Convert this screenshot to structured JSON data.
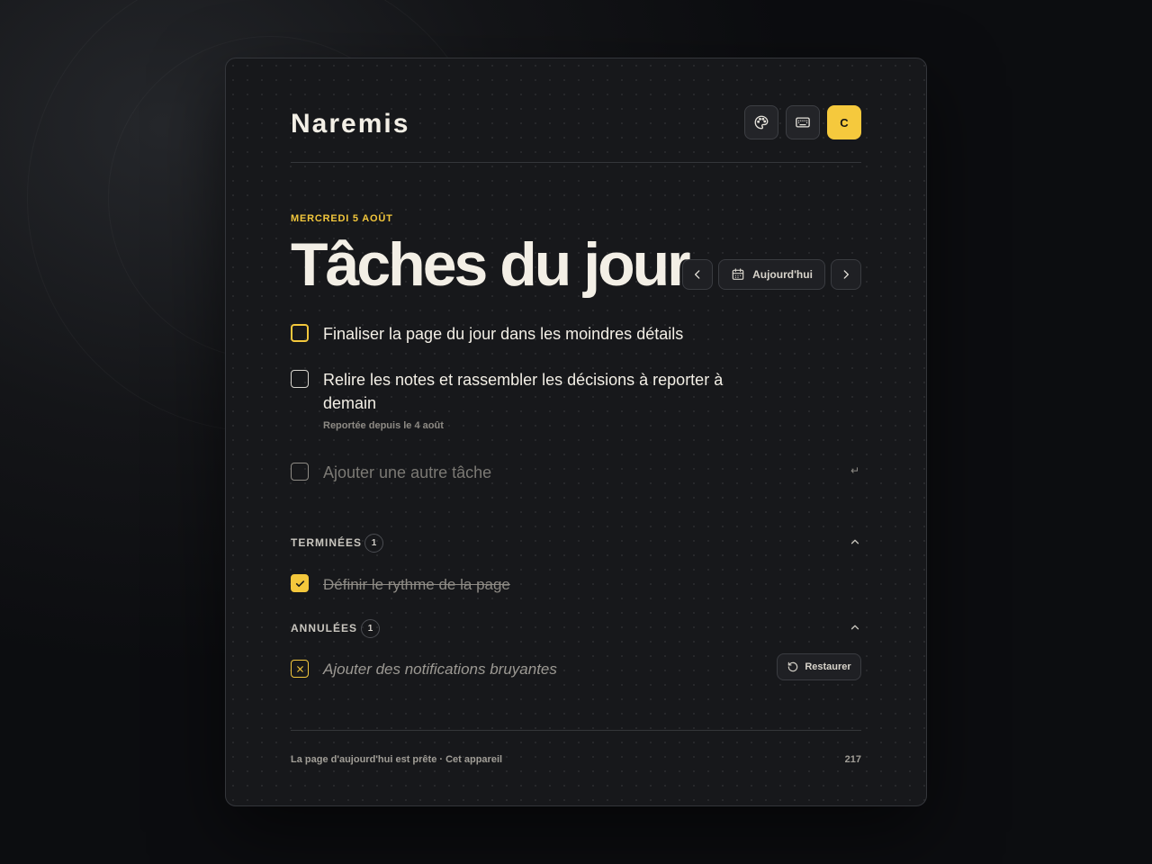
{
  "app": {
    "name": "Naremis"
  },
  "header": {
    "buttons": [
      {
        "name": "theme",
        "icon": "palette-icon"
      },
      {
        "name": "shortcuts",
        "icon": "keyboard-icon"
      }
    ],
    "avatar_initial": "C"
  },
  "day": {
    "date_label": "MERCREDI 5 AOÛT",
    "title": "Tâches du jour",
    "nav": {
      "prev_icon": "chevron-left-icon",
      "today_label": "Aujourd'hui",
      "next_icon": "chevron-right-icon"
    }
  },
  "tasks": [
    {
      "text": "Finaliser la page du jour dans les moindres détails",
      "state": "active"
    },
    {
      "text": "Relire les notes et rassembler les décisions à reporter à demain",
      "note": "Reportée depuis le 4 août",
      "state": "open"
    }
  ],
  "new_task": {
    "placeholder": "Ajouter une autre tâche",
    "enter_hint": "↵"
  },
  "completed": {
    "label": "TERMINÉES",
    "count": "1",
    "items": [
      {
        "text": "Définir le rythme de la page"
      }
    ]
  },
  "cancelled": {
    "label": "ANNULÉES",
    "count": "1",
    "items": [
      {
        "text": "Ajouter des notifications bruyantes",
        "restore_label": "Restaurer"
      }
    ]
  },
  "footer": {
    "status": "La page d'aujourd'hui est prête · Cet appareil",
    "number": "217"
  },
  "colors": {
    "accent": "#f3c73c",
    "background": "#17181b",
    "text": "#f3efe6"
  }
}
